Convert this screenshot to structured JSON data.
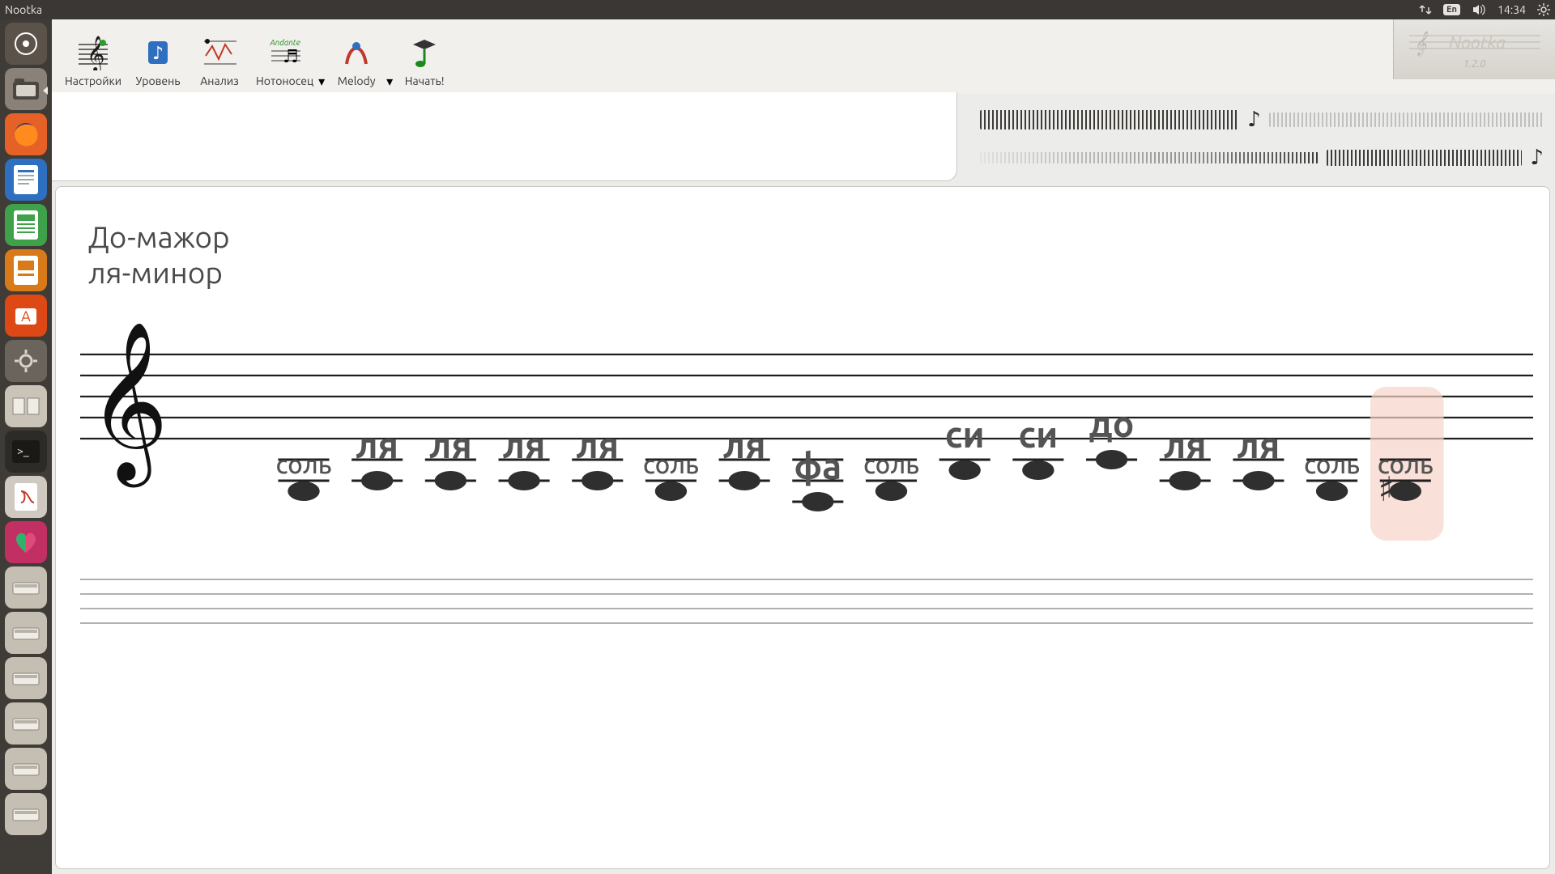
{
  "os_bar": {
    "title": "Nootka",
    "lang": "En",
    "time": "14:34"
  },
  "dock": {
    "apps": [
      {
        "name": "dash-icon",
        "color": "#5b534a"
      },
      {
        "name": "files-icon",
        "color": "#8a8279"
      },
      {
        "name": "firefox-icon",
        "color": "#e56125"
      },
      {
        "name": "writer-icon",
        "color": "#2f6fbf"
      },
      {
        "name": "calc-icon",
        "color": "#3fa24a"
      },
      {
        "name": "impress-icon",
        "color": "#d97a1a"
      },
      {
        "name": "software-icon",
        "color": "#dd4814"
      },
      {
        "name": "settings-gear-icon",
        "color": "#6a645c"
      },
      {
        "name": "dictionary-icon",
        "color": "#c9c3b8"
      },
      {
        "name": "terminal-icon",
        "color": "#2d2b28"
      },
      {
        "name": "pdf-icon",
        "color": "#cfc9c1"
      },
      {
        "name": "heart-icon",
        "color": "#c22f63"
      },
      {
        "name": "drive1-icon",
        "color": "#c4beb3"
      },
      {
        "name": "drive2-icon",
        "color": "#c4beb3"
      },
      {
        "name": "drive3-icon",
        "color": "#c4beb3"
      },
      {
        "name": "drive4-icon",
        "color": "#c4beb3"
      },
      {
        "name": "drive5-icon",
        "color": "#c4beb3"
      },
      {
        "name": "drive6-icon",
        "color": "#c4beb3"
      }
    ]
  },
  "toolbar": {
    "settings": "Настройки",
    "level": "Уровень",
    "analysis": "Анализ",
    "staff": "Нотоносец",
    "melody": "Melody",
    "start": "Начать!"
  },
  "brand": {
    "name": "Nootka",
    "version": "1.2.0"
  },
  "score": {
    "title_major": "До-мажор",
    "title_minor": "ля-минор",
    "notes": [
      {
        "pitch": "G3",
        "label": "соль",
        "big": false,
        "sharp": false
      },
      {
        "pitch": "A3",
        "label": "ля",
        "big": true,
        "sharp": false
      },
      {
        "pitch": "A3",
        "label": "ля",
        "big": true,
        "sharp": false
      },
      {
        "pitch": "A3",
        "label": "ля",
        "big": true,
        "sharp": false
      },
      {
        "pitch": "A3",
        "label": "ля",
        "big": true,
        "sharp": false
      },
      {
        "pitch": "G3",
        "label": "соль",
        "big": false,
        "sharp": false
      },
      {
        "pitch": "A3",
        "label": "ля",
        "big": true,
        "sharp": false
      },
      {
        "pitch": "F3",
        "label": "фа",
        "big": true,
        "sharp": false
      },
      {
        "pitch": "G3",
        "label": "соль",
        "big": false,
        "sharp": false
      },
      {
        "pitch": "B3",
        "label": "си",
        "big": true,
        "sharp": false
      },
      {
        "pitch": "B3",
        "label": "си",
        "big": true,
        "sharp": false
      },
      {
        "pitch": "C4",
        "label": "до",
        "big": true,
        "sharp": false
      },
      {
        "pitch": "A3",
        "label": "ля",
        "big": true,
        "sharp": false
      },
      {
        "pitch": "A3",
        "label": "ля",
        "big": true,
        "sharp": false
      },
      {
        "pitch": "G3",
        "label": "соль",
        "big": false,
        "sharp": false
      },
      {
        "pitch": "G#3",
        "label": "соль",
        "big": false,
        "sharp": true,
        "highlight": true
      }
    ]
  }
}
